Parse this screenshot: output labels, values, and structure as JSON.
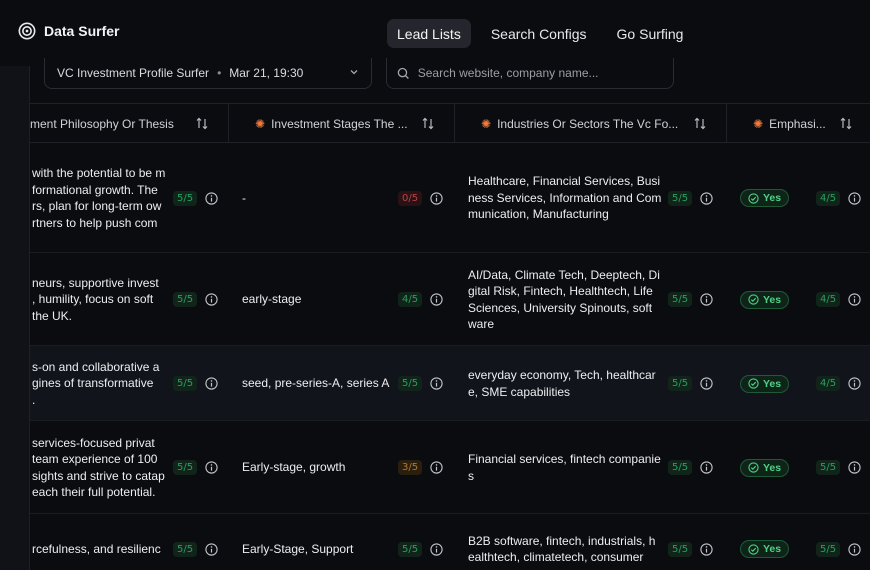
{
  "app": {
    "name": "Data Surfer"
  },
  "nav": {
    "tabs": [
      {
        "label": "Lead Lists",
        "active": true
      },
      {
        "label": "Search Configs"
      },
      {
        "label": "Go Surfing"
      }
    ]
  },
  "list_selector": {
    "name": "VC Investment Profile Surfer",
    "separator": "•",
    "date": "Mar 21, 19:30"
  },
  "search": {
    "placeholder": "Search website, company name..."
  },
  "colors": {
    "accent_orange": "#f07a3a",
    "good": "#27a061",
    "bad": "#b8424a",
    "mid": "#b5782c",
    "yes": "#4fd184"
  },
  "table": {
    "columns": [
      {
        "label": "ment Philosophy Or Thesis",
        "icon": ""
      },
      {
        "label": "Investment Stages The ...",
        "icon": "sparkle-icon"
      },
      {
        "label": "Industries Or Sectors The Vc Fo...",
        "icon": "sparkle-icon"
      },
      {
        "label": "Emphasi...",
        "icon": "sparkle-icon"
      }
    ],
    "rows": [
      {
        "philosophy": [
          "with the potential to be m",
          "formational growth. The",
          "rs, plan for long-term ow",
          "rtners to help push com"
        ],
        "philosophy_score": "5/5",
        "stage": [
          "-"
        ],
        "stage_score": "0/5",
        "stage_level": "bad",
        "industries": [
          "Healthcare, Financial Services, Busi",
          "ness Services, Information and Com",
          "munication, Manufacturing"
        ],
        "industries_score": "5/5",
        "emphasis": "Yes",
        "emphasis_score": "4/5"
      },
      {
        "philosophy": [
          "neurs, supportive invest",
          ", humility, focus on soft",
          " the UK."
        ],
        "philosophy_score": "5/5",
        "stage": [
          "early-stage"
        ],
        "stage_score": "4/5",
        "stage_level": "good",
        "industries": [
          "AI/Data, Climate Tech, Deeptech, Di",
          "gital Risk, Fintech, Healthtech, Life",
          "Sciences, University Spinouts, soft",
          "ware"
        ],
        "industries_score": "5/5",
        "emphasis": "Yes",
        "emphasis_score": "4/5"
      },
      {
        "philosophy": [
          "s-on and collaborative a",
          "gines of transformative",
          "."
        ],
        "philosophy_score": "5/5",
        "stage": [
          "seed, pre-series-A, series A"
        ],
        "stage_score": "5/5",
        "stage_level": "good",
        "industries": [
          "everyday economy, Tech, healthcar",
          "e, SME capabilities"
        ],
        "industries_score": "5/5",
        "emphasis": "Yes",
        "emphasis_score": "4/5"
      },
      {
        "philosophy": [
          "services-focused privat",
          " team experience of 100",
          "sights and strive to catap",
          "each their full potential."
        ],
        "philosophy_score": "5/5",
        "stage": [
          "Early-stage, growth"
        ],
        "stage_score": "3/5",
        "stage_level": "mid",
        "industries": [
          "Financial services, fintech companie",
          "s"
        ],
        "industries_score": "5/5",
        "emphasis": "Yes",
        "emphasis_score": "5/5"
      },
      {
        "philosophy": [
          "rcefulness, and resilienc"
        ],
        "philosophy_score": "5/5",
        "stage": [
          "Early-Stage, Support"
        ],
        "stage_score": "5/5",
        "stage_level": "good",
        "industries": [
          "B2B software, fintech, industrials, h",
          "ealthtech, climatetech, consumer"
        ],
        "industries_score": "5/5",
        "emphasis": "Yes",
        "emphasis_score": "5/5"
      }
    ]
  }
}
